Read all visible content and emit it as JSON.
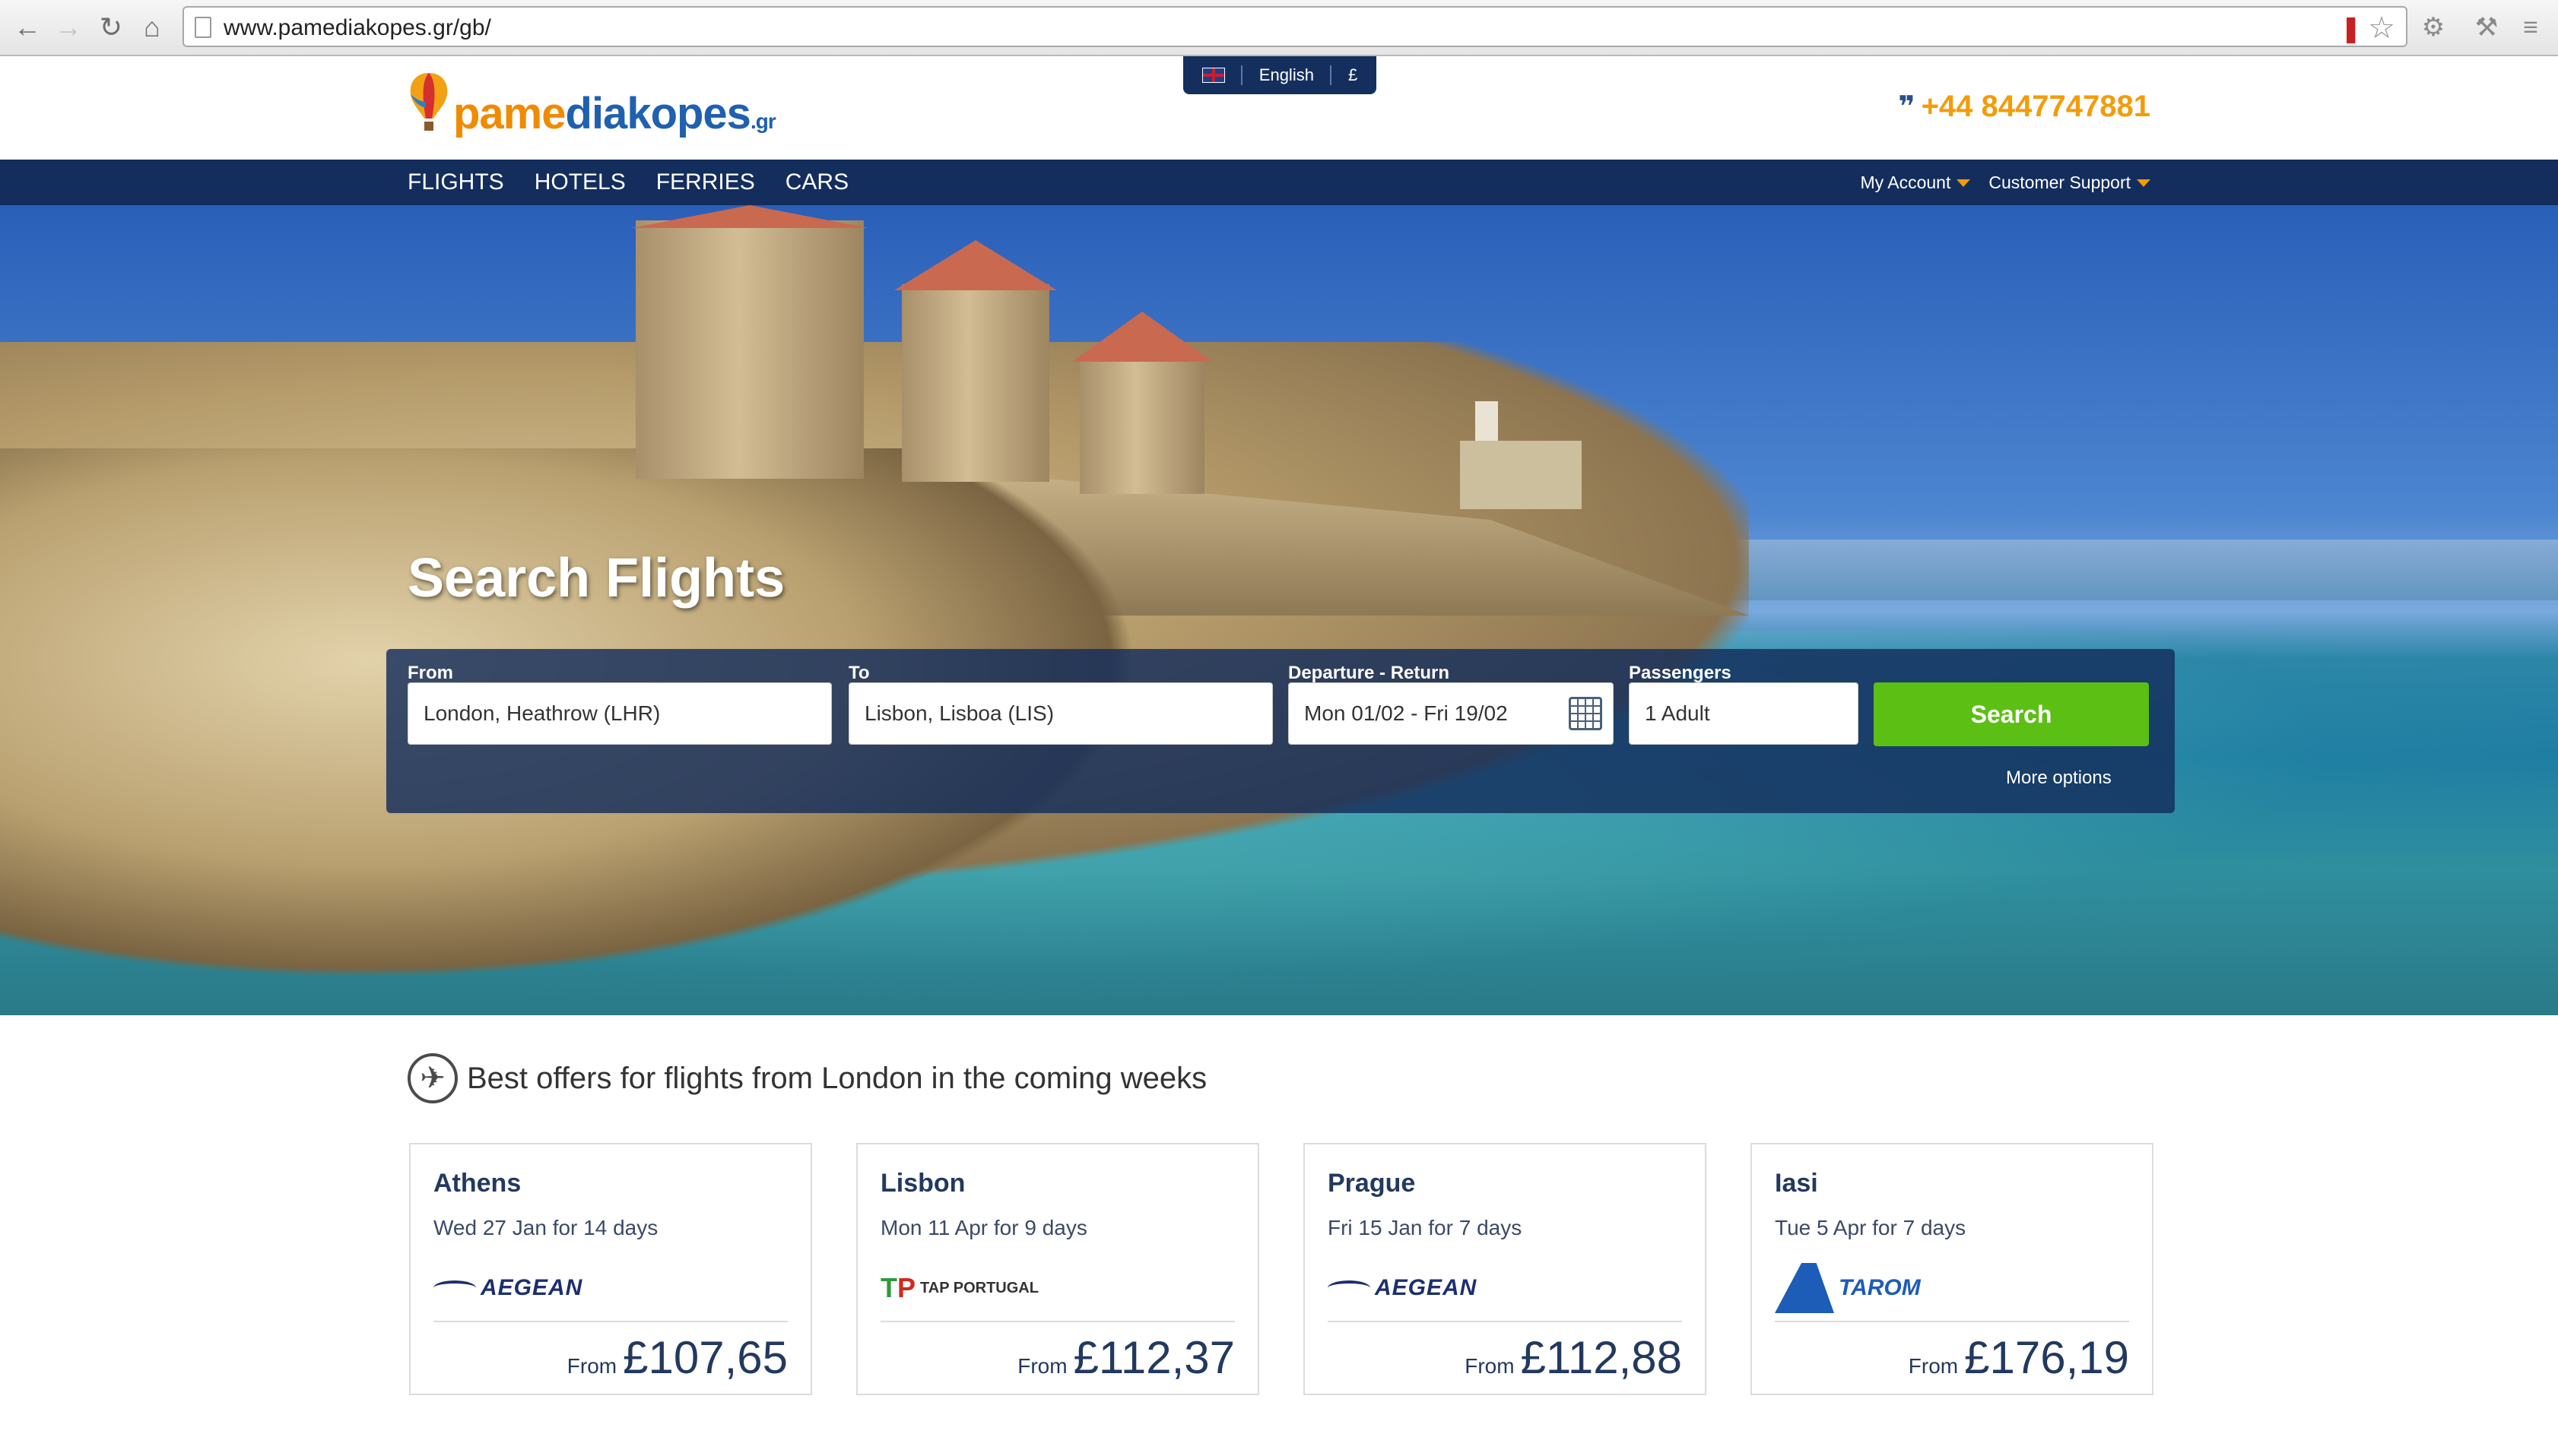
{
  "browser": {
    "url": "www.pamediakopes.gr/gb/",
    "back_icon": "arrow-left-icon",
    "forward_icon": "arrow-right-icon",
    "reload_icon": "reload-icon",
    "home_icon": "home-icon"
  },
  "header": {
    "logo_part1": "pame",
    "logo_part2": "diakopes",
    "logo_suffix": ".gr",
    "language": "English",
    "currency": "£",
    "phone": "+44 8447747881"
  },
  "nav": {
    "items": [
      "FLIGHTS",
      "HOTELS",
      "FERRIES",
      "CARS"
    ],
    "account": "My Account",
    "support": "Customer Support"
  },
  "hero": {
    "title": "Search Flights"
  },
  "search": {
    "from_label": "From",
    "from_value": "London, Heathrow (LHR)",
    "to_label": "To",
    "to_value": "Lisbon, Lisboa (LIS)",
    "dates_label": "Departure - Return",
    "dates_value": "Mon 01/02 - Fri 19/02",
    "passengers_label": "Passengers",
    "passengers_value": "1 Adult",
    "button": "Search",
    "more_options": "More options"
  },
  "offers": {
    "title": "Best offers for flights from London in the coming weeks",
    "cards": [
      {
        "city": "Athens",
        "dates": "Wed 27 Jan for 14 days",
        "airline": "AEGEAN",
        "from": "From",
        "price": "£107,65"
      },
      {
        "city": "Lisbon",
        "dates": "Mon 11 Apr for 9 days",
        "airline": "TAP PORTUGAL",
        "from": "From",
        "price": "£112,37"
      },
      {
        "city": "Prague",
        "dates": "Fri 15 Jan for 7 days",
        "airline": "AEGEAN",
        "from": "From",
        "price": "£112,88"
      },
      {
        "city": "Iasi",
        "dates": "Tue 5 Apr for 7 days",
        "airline": "TAROM",
        "from": "From",
        "price": "£176,19"
      }
    ]
  },
  "colors": {
    "navy": "#132d5c",
    "orange": "#f39c0a",
    "green": "#5cbf14"
  }
}
